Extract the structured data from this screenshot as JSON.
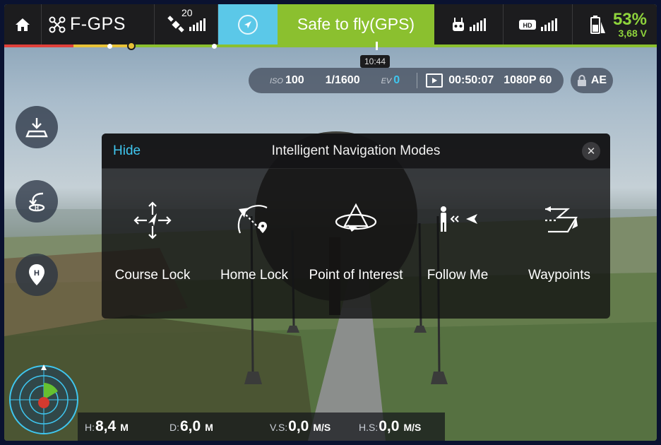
{
  "topbar": {
    "flight_mode": "F-GPS",
    "satellite_count": "20",
    "status": "Safe to fly(GPS)",
    "battery_percent": "53%",
    "battery_voltage": "3,68 V"
  },
  "timeline": {
    "time": "10:44"
  },
  "camera": {
    "iso_label": "ISO",
    "iso_value": "100",
    "shutter": "1/1600",
    "ev_label": "EV",
    "ev_value": "0",
    "record_time": "00:50:07",
    "resolution": "1080P 60",
    "ae_label": "AE"
  },
  "modal": {
    "hide_label": "Hide",
    "title": "Intelligent Navigation Modes",
    "modes": [
      {
        "label": "Course Lock"
      },
      {
        "label": "Home Lock"
      },
      {
        "label": "Point of Interest"
      },
      {
        "label": "Follow Me"
      },
      {
        "label": "Waypoints"
      }
    ]
  },
  "telemetry": {
    "height_label": "H:",
    "height_value": "8,4",
    "height_unit": "M",
    "distance_label": "D:",
    "distance_value": "6,0",
    "distance_unit": "M",
    "vs_label": "V.S:",
    "vs_value": "0,0",
    "vs_unit": "M/S",
    "hs_label": "H.S:",
    "hs_value": "0,0",
    "hs_unit": "M/S"
  },
  "colors": {
    "status_green": "#8bc02f",
    "accent_cyan": "#3fc6ef",
    "battery_green": "#8fd43c"
  },
  "icons": [
    "home-icon",
    "drone-icon",
    "satellite-icon",
    "compass-icon",
    "remote-controller-icon",
    "hd-signal-icon",
    "battery-icon",
    "lock-icon",
    "takeoff-icon",
    "return-home-icon",
    "home-point-icon",
    "close-icon",
    "course-lock-icon",
    "home-lock-icon",
    "point-of-interest-icon",
    "follow-me-icon",
    "waypoints-icon",
    "radar-icon"
  ]
}
